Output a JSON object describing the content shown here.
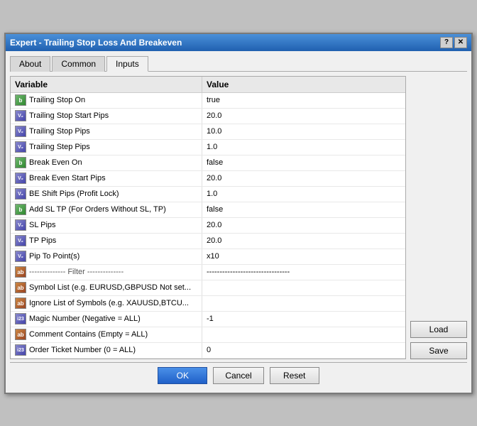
{
  "window": {
    "title": "Expert - Trailing Stop Loss And Breakeven",
    "help_btn": "?",
    "close_btn": "✕"
  },
  "tabs": [
    {
      "label": "About",
      "active": false
    },
    {
      "label": "Common",
      "active": false
    },
    {
      "label": "Inputs",
      "active": true
    }
  ],
  "table": {
    "headers": [
      "Variable",
      "Value"
    ],
    "rows": [
      {
        "icon_type": "bool",
        "icon_label": "b",
        "variable": "Trailing Stop On",
        "value": "true"
      },
      {
        "icon_type": "num",
        "icon_label": "V2",
        "variable": "Trailing Stop Start Pips",
        "value": "20.0"
      },
      {
        "icon_type": "num",
        "icon_label": "V2",
        "variable": "Trailing Stop Pips",
        "value": "10.0"
      },
      {
        "icon_type": "num",
        "icon_label": "V2",
        "variable": "Trailing Step Pips",
        "value": "1.0"
      },
      {
        "icon_type": "bool",
        "icon_label": "b",
        "variable": "Break Even On",
        "value": "false"
      },
      {
        "icon_type": "num",
        "icon_label": "V2",
        "variable": "Break Even Start Pips",
        "value": "20.0"
      },
      {
        "icon_type": "num",
        "icon_label": "V2",
        "variable": "BE Shift Pips (Profit Lock)",
        "value": "1.0"
      },
      {
        "icon_type": "bool",
        "icon_label": "b",
        "variable": "Add SL TP (For Orders Without SL, TP)",
        "value": "false"
      },
      {
        "icon_type": "num",
        "icon_label": "V2",
        "variable": "SL Pips",
        "value": "20.0"
      },
      {
        "icon_type": "num",
        "icon_label": "V2",
        "variable": "TP Pips",
        "value": "20.0"
      },
      {
        "icon_type": "num",
        "icon_label": "V2",
        "variable": "Pip To Point(s)",
        "value": "x10"
      },
      {
        "icon_type": "str",
        "icon_label": "ab",
        "variable": "-------------- Filter --------------",
        "value": "--------------------------------"
      },
      {
        "icon_type": "str",
        "icon_label": "ab",
        "variable": "Symbol List (e.g. EURUSD,GBPUSD Not set...",
        "value": ""
      },
      {
        "icon_type": "str",
        "icon_label": "ab",
        "variable": "Ignore List of Symbols (e.g. XAUUSD,BTCU...",
        "value": ""
      },
      {
        "icon_type": "num",
        "icon_label": "i23",
        "variable": "Magic Number (Negative = ALL)",
        "value": "-1"
      },
      {
        "icon_type": "str",
        "icon_label": "ab",
        "variable": "Comment Contains (Empty = ALL)",
        "value": ""
      },
      {
        "icon_type": "num",
        "icon_label": "i23",
        "variable": "Order Ticket Number (0 = ALL)",
        "value": "0"
      }
    ]
  },
  "side_buttons": {
    "load_label": "Load",
    "save_label": "Save"
  },
  "footer_buttons": {
    "ok_label": "OK",
    "cancel_label": "Cancel",
    "reset_label": "Reset"
  }
}
